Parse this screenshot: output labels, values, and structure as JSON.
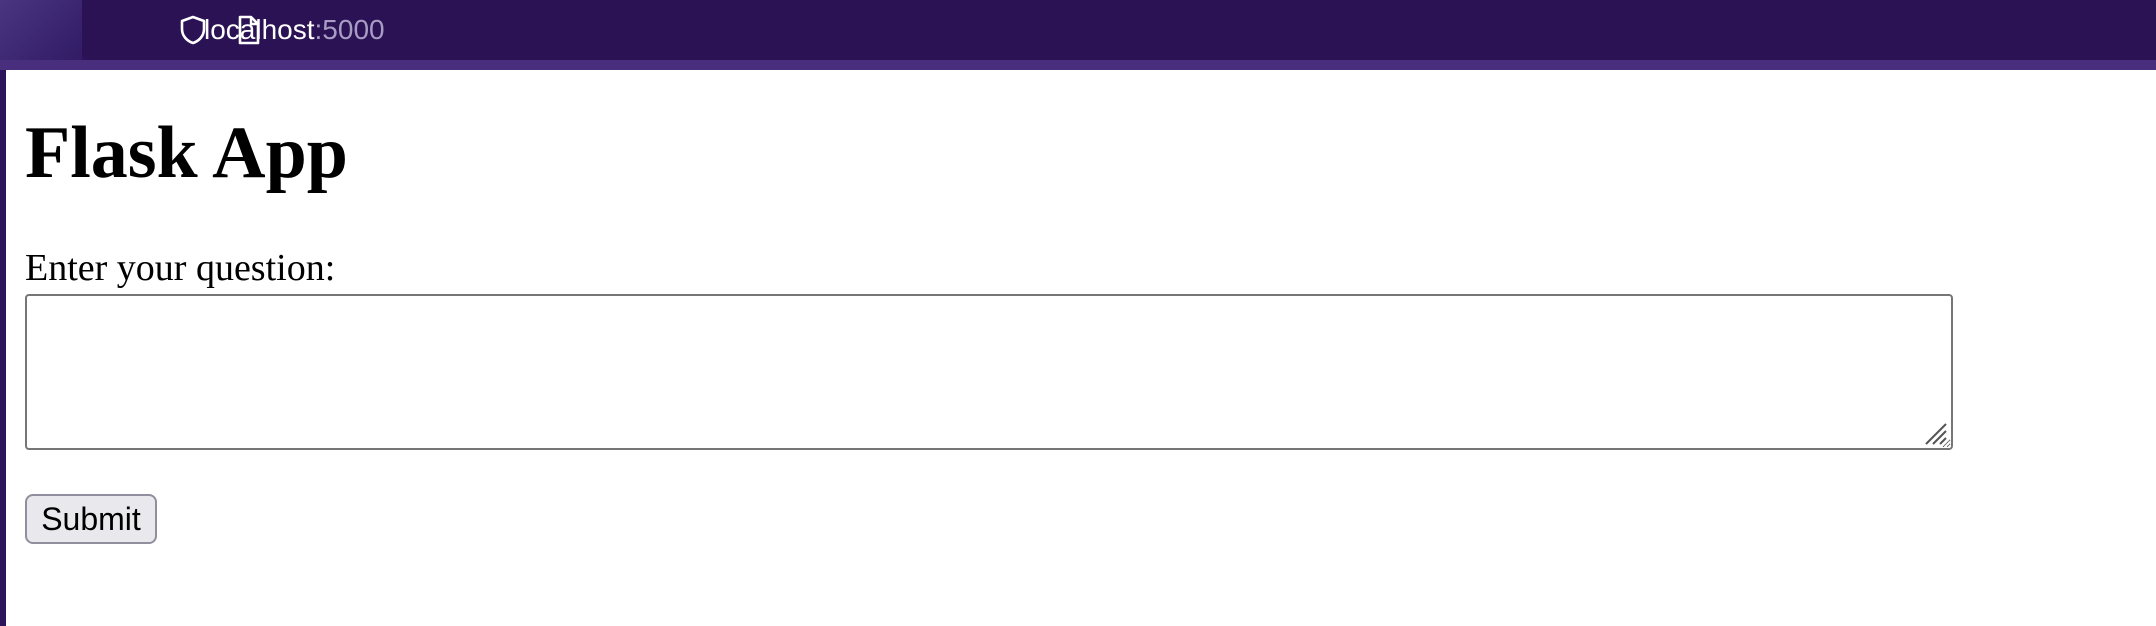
{
  "browser": {
    "url_host": "localhost",
    "url_port": ":5000",
    "icons": [
      "shield-icon",
      "page-icon"
    ],
    "colors": {
      "chrome_background": "#2b1459",
      "url_port_text": "#a99cc4"
    }
  },
  "page": {
    "title": "Flask App",
    "form": {
      "question_label": "Enter your question:",
      "question_value": "",
      "submit_label": "Submit"
    }
  }
}
